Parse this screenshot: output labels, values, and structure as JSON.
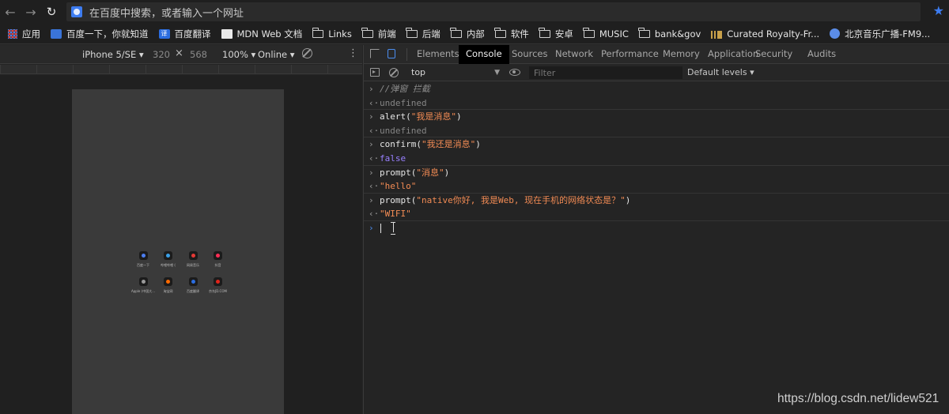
{
  "browser": {
    "address_placeholder": "在百度中搜索，或者输入一个网址"
  },
  "bookmarks": [
    {
      "label": "应用",
      "icon": "apps-icon"
    },
    {
      "label": "百度一下，你就知道",
      "icon": "baidu-icon"
    },
    {
      "label": "百度翻译",
      "icon": "translate-icon"
    },
    {
      "label": "MDN Web 文档",
      "icon": "mdn-icon"
    },
    {
      "label": "Links",
      "icon": "folder-icon"
    },
    {
      "label": "前端",
      "icon": "folder-icon"
    },
    {
      "label": "后端",
      "icon": "folder-icon"
    },
    {
      "label": "内部",
      "icon": "folder-icon"
    },
    {
      "label": "软件",
      "icon": "folder-icon"
    },
    {
      "label": "安卓",
      "icon": "folder-icon"
    },
    {
      "label": "MUSIC",
      "icon": "folder-icon"
    },
    {
      "label": "bank&gov",
      "icon": "folder-icon"
    },
    {
      "label": "Curated Royalty-Fr...",
      "icon": "bars-icon"
    },
    {
      "label": "北京音乐广播-FM9...",
      "icon": "radio-icon"
    }
  ],
  "device_toolbar": {
    "device": "iPhone 5/SE",
    "width": "320",
    "height": "568",
    "zoom": "100%",
    "network": "Online"
  },
  "devtools": {
    "tabs": [
      "Elements",
      "Console",
      "Sources",
      "Network",
      "Performance",
      "Memory",
      "Application",
      "Security",
      "Audits"
    ],
    "active_tab": "Console",
    "context": "top",
    "filter_placeholder": "Filter",
    "levels": "Default levels"
  },
  "console": {
    "lines": [
      {
        "kind": "in",
        "parts": [
          {
            "t": "//弹窗 拦截",
            "c": "comment"
          }
        ]
      },
      {
        "kind": "out",
        "parts": [
          {
            "t": "undefined",
            "c": "undef"
          }
        ]
      },
      {
        "kind": "in",
        "parts": [
          {
            "t": "alert(",
            "c": "plain"
          },
          {
            "t": "\"我是消息\"",
            "c": "str"
          },
          {
            "t": ")",
            "c": "plain"
          }
        ]
      },
      {
        "kind": "out",
        "parts": [
          {
            "t": "undefined",
            "c": "undef"
          }
        ]
      },
      {
        "kind": "in",
        "parts": [
          {
            "t": "confirm(",
            "c": "plain"
          },
          {
            "t": "\"我还是消息\"",
            "c": "str"
          },
          {
            "t": ")",
            "c": "plain"
          }
        ]
      },
      {
        "kind": "out",
        "parts": [
          {
            "t": "false",
            "c": "bool"
          }
        ]
      },
      {
        "kind": "in",
        "parts": [
          {
            "t": "prompt(",
            "c": "plain"
          },
          {
            "t": "\"消息\"",
            "c": "str"
          },
          {
            "t": ")",
            "c": "plain"
          }
        ]
      },
      {
        "kind": "out",
        "parts": [
          {
            "t": "\"hello\"",
            "c": "dstr"
          }
        ]
      },
      {
        "kind": "in",
        "parts": [
          {
            "t": "prompt(",
            "c": "plain"
          },
          {
            "t": "\"native你好, 我是Web, 现在手机的网络状态是？\"",
            "c": "str"
          },
          {
            "t": ")",
            "c": "plain"
          }
        ]
      },
      {
        "kind": "out",
        "parts": [
          {
            "t": "\"WIFI\"",
            "c": "dstr"
          }
        ]
      }
    ]
  },
  "phone_apps": [
    {
      "label": "百度一下",
      "dot": "#4c7ef0"
    },
    {
      "label": "哔哩哔哩 (",
      "dot": "#3aa0e8"
    },
    {
      "label": "网易音乐",
      "dot": "#e53935"
    },
    {
      "label": "抖音",
      "dot": "#ff2d55"
    },
    {
      "label": "Apple (中国大...",
      "dot": "#9a9a9a"
    },
    {
      "label": "淘宝网",
      "dot": "#ff6a00"
    },
    {
      "label": "百度翻译",
      "dot": "#2b6de0"
    },
    {
      "label": "京东JD.COM",
      "dot": "#e1251b"
    }
  ],
  "watermark": "https://blog.csdn.net/lidew521"
}
